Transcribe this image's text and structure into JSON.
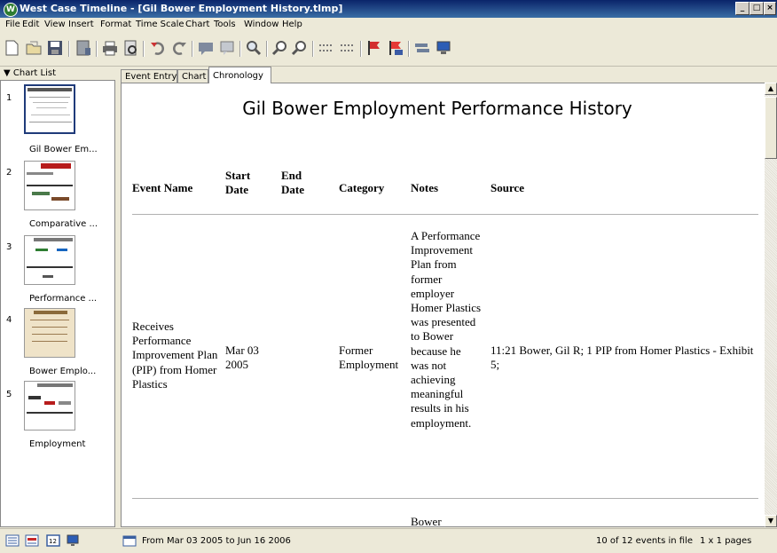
{
  "window": {
    "title": "West Case Timeline - [Gil Bower Employment History.tlmp]",
    "app_icon_letter": "W"
  },
  "menu": [
    "File",
    "Edit",
    "View",
    "Insert",
    "Format",
    "Time Scale",
    "Chart",
    "Tools",
    "Window",
    "Help"
  ],
  "toolbar": {
    "icons": [
      "new-icon",
      "open-icon",
      "save-icon",
      "save-as-icon",
      "print-icon",
      "print-preview-icon",
      "undo-icon",
      "redo-icon",
      "comment-icon",
      "comment-edit-icon",
      "zoom-icon",
      "zoom-in-icon",
      "zoom-out-icon",
      "expand-icon",
      "collapse-icon",
      "flag-icon",
      "flag-edit-icon",
      "list-icon",
      "monitor-icon"
    ]
  },
  "sidebar": {
    "header": "▼ Chart List",
    "items": [
      {
        "num": "1",
        "label": "Gil Bower Em..."
      },
      {
        "num": "2",
        "label": "Comparative ..."
      },
      {
        "num": "3",
        "label": "Performance ..."
      },
      {
        "num": "4",
        "label": "Bower Emplo..."
      },
      {
        "num": "5",
        "label": "Employment"
      }
    ]
  },
  "tabs": [
    "Event Entry",
    "Chart",
    "Chronology"
  ],
  "report": {
    "title": "Gil Bower Employment Performance History",
    "columns": {
      "event": "Event Name",
      "start": "Start\nDate",
      "end": "End\nDate",
      "category": "Category",
      "notes": "Notes",
      "source": "Source"
    },
    "rows": [
      {
        "event": "Receives Performance Improvement Plan (PIP) from Homer Plastics",
        "start": "Mar 03 2005",
        "end": "",
        "category": "Former Employment",
        "notes": "A Performance Improvement Plan from former employer Homer Plastics was presented to Bower because he was not achieving meaningful results in his employment.",
        "source": "11:21 Bower, Gil R; 1 PIP from Homer Plastics - Exhibit 5;"
      },
      {
        "notes": "Bower"
      }
    ]
  },
  "status": {
    "range": "From Mar 03 2005 to Jun 16 2006",
    "events": "10 of 12 events in file",
    "pages": "1 x 1 pages"
  }
}
